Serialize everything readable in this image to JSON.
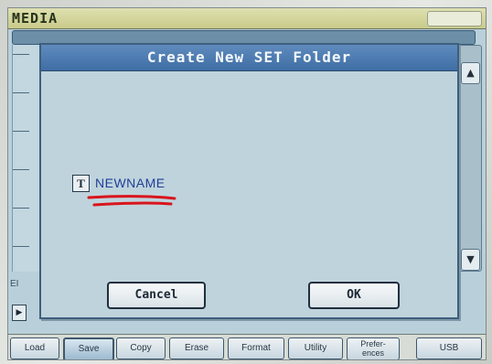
{
  "header": {
    "title": "MEDIA"
  },
  "list": {
    "side_label": "EI",
    "play_glyph": "▶"
  },
  "scroll": {
    "up_glyph": "▲",
    "down_glyph": "▼"
  },
  "dialog": {
    "title": "Create New SET Folder",
    "name_icon": "T",
    "name_value": "NEWNAME",
    "cancel_label": "Cancel",
    "ok_label": "OK"
  },
  "tabs": [
    {
      "label": "Load",
      "selected": false
    },
    {
      "label": "Save",
      "selected": true
    },
    {
      "label": "Copy",
      "selected": false
    },
    {
      "label": "Erase",
      "selected": false
    },
    {
      "label": "Format",
      "selected": false
    },
    {
      "label": "Utility",
      "selected": false
    },
    {
      "label": "Prefer-\nences",
      "selected": false
    },
    {
      "label": "USB",
      "selected": false
    }
  ],
  "colors": {
    "accent": "#3f6ea5",
    "annotation": "#d9141c",
    "name_text": "#1f3f97"
  }
}
